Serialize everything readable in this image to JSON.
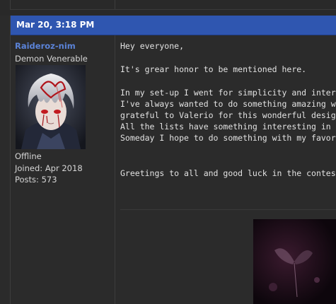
{
  "post": {
    "date": "Mar 20, 3:18 PM",
    "author": {
      "username": "Raideroz-nim",
      "rank": "Demon Venerable",
      "status": "Offline",
      "joined": "Joined: Apr 2018",
      "posts": "Posts: 573"
    },
    "message": {
      "greeting": "Hey everyone,",
      "honor": "It's grear honor to be mentioned here.",
      "lines": [
        "In my set-up I went for simplicity and interesting colors",
        "I've always wanted to do something amazing with my l",
        "grateful to Valerio for this wonderful design. It's amazin",
        "All the lists have something interesting in them, it's gre",
        "Someday I hope to do something with my favorite Gens"
      ],
      "closing": "Greetings to all and good luck in the contest."
    }
  },
  "colors": {
    "header_bg": "#2f56b0",
    "username": "#5b83d8",
    "page_bg": "#2b2b2b"
  },
  "icons": {
    "avatar": "anime-avatar-white-hair-red-eyes",
    "post_image": "dark-artwork-butterfly"
  }
}
